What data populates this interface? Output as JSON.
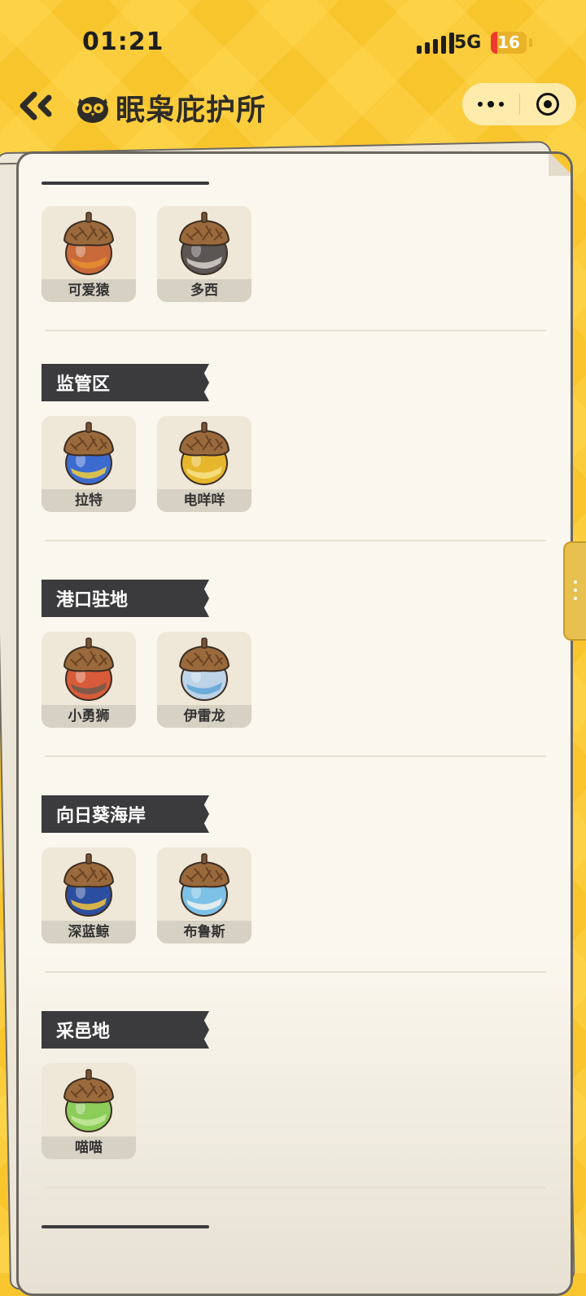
{
  "status_bar": {
    "time": "01:21",
    "network": "5G",
    "battery": "16"
  },
  "nav": {
    "title": "眠枭庇护所",
    "back_icon": "double-chevron-left-icon",
    "title_icon": "owl-icon"
  },
  "capsule": {
    "more_icon": "more-dots-icon",
    "close_icon": "target-close-icon"
  },
  "sections": [
    {
      "title": "",
      "items": [
        {
          "name": "可爱猿",
          "acorn_color": "#c96a3a",
          "accent": "#e58f2f"
        },
        {
          "name": "多西",
          "acorn_color": "#5a5654",
          "accent": "#d8d2cc"
        }
      ]
    },
    {
      "title": "监管区",
      "items": [
        {
          "name": "拉特",
          "acorn_color": "#3c6bd0",
          "accent": "#f2cf3b"
        },
        {
          "name": "电咩咩",
          "acorn_color": "#e6b72c",
          "accent": "#f7e48a"
        }
      ]
    },
    {
      "title": "港口驻地",
      "items": [
        {
          "name": "小勇狮",
          "acorn_color": "#d85b3a",
          "accent": "#6e5a4c"
        },
        {
          "name": "伊雷龙",
          "acorn_color": "#bcd3e8",
          "accent": "#5fa3d6"
        }
      ]
    },
    {
      "title": "向日葵海岸",
      "items": [
        {
          "name": "深蓝鲸",
          "acorn_color": "#2c4ea0",
          "accent": "#f4c53b"
        },
        {
          "name": "布鲁斯",
          "acorn_color": "#7cc1e6",
          "accent": "#f5f3ee"
        }
      ]
    },
    {
      "title": "采邑地",
      "items": [
        {
          "name": "喵喵",
          "acorn_color": "#8ccd5a",
          "accent": "#c4e89b"
        }
      ]
    }
  ]
}
